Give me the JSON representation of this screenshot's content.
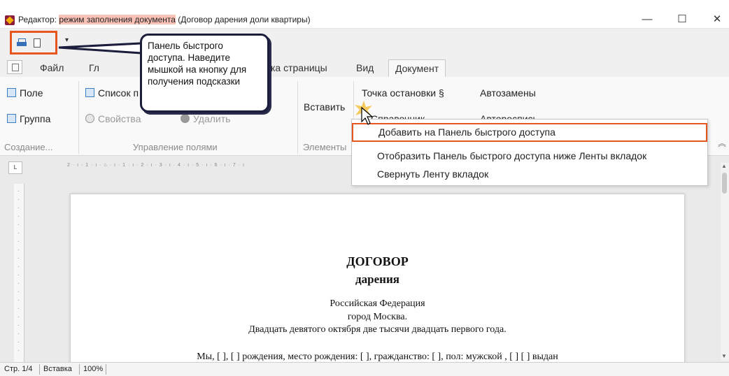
{
  "window": {
    "title_prefix": "Редактор: ",
    "title_mode": "режим заполнения документа",
    "title_doc": " (Договор дарения доли квартиры)",
    "minimize": "—",
    "maximize": "☐",
    "close": "✕"
  },
  "qat": {
    "more": "▾"
  },
  "tabs": [
    {
      "label": "Файл"
    },
    {
      "label": "Гл"
    },
    {
      "label": "ка страницы"
    },
    {
      "label": "Вид"
    },
    {
      "label": "Документ"
    }
  ],
  "ribbon": {
    "field": "Поле",
    "group": "Группа",
    "field_list": "Список п",
    "properties": "Свойства",
    "delete": "Удалить",
    "partial": "ть",
    "insert": "Вставить",
    "breakpoint": "Точка остановки §",
    "autoreplace": "Автозамены",
    "reference": "Справочник",
    "autosign": "Автороспись",
    "groups": {
      "create": "Создание...",
      "manage_fields": "Управление полями",
      "elements": "Элементы"
    },
    "collapse": "︽"
  },
  "context_menu": [
    {
      "label": "Добавить на Панель быстрого доступа"
    },
    {
      "label": "Отобразить Панель быстрого доступа ниже Ленты вкладок"
    },
    {
      "label": "Свернуть Ленту вкладок"
    }
  ],
  "callout": {
    "text": "Панель быстрого доступа. Наведите мышкой на кнопку для получения подсказки"
  },
  "ruler": {
    "corner": "L",
    "marks": "2 · ı · 1 · ı · ⌂ · ı · 1 · ı · 2 · ı · 3 · ı · 4 · ı · 5 · ı · 6 · ı · 7 · ı"
  },
  "document": {
    "title": "ДОГОВОР",
    "subtitle": "дарения",
    "line1": "Российская Федерация",
    "line2": "город Москва.",
    "line3": "Двадцать девятого октября две тысячи двадцать первого года.",
    "line4": "Мы, [ ], [ ] рождения, место рождения: [ ], гражданство: [ ], пол: мужской , [ ] [ ] выдан"
  },
  "status": {
    "page": "Стр. 1/4",
    "mode": "Вставка",
    "zoom": "100%"
  },
  "colors": {
    "highlight": "#e8561f",
    "title_highlight": "#f9c2b7",
    "callout_border": "#1c1c3c"
  }
}
